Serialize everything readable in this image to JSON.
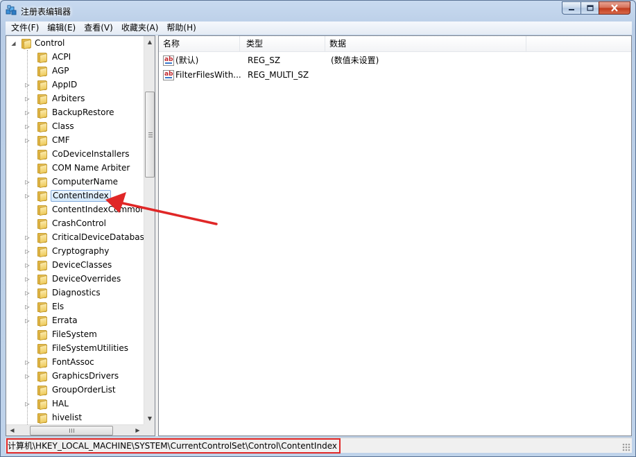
{
  "window": {
    "title": "注册表编辑器",
    "icon": "regedit-icon"
  },
  "menu": [
    {
      "label": "文件(F)"
    },
    {
      "label": "编辑(E)"
    },
    {
      "label": "查看(V)"
    },
    {
      "label": "收藏夹(A)"
    },
    {
      "label": "帮助(H)"
    }
  ],
  "tree": {
    "root": {
      "label": "Control",
      "expanded": true
    },
    "items": [
      {
        "label": "ACPI",
        "has_children": false
      },
      {
        "label": "AGP",
        "has_children": false
      },
      {
        "label": "AppID",
        "has_children": true
      },
      {
        "label": "Arbiters",
        "has_children": true
      },
      {
        "label": "BackupRestore",
        "has_children": true
      },
      {
        "label": "Class",
        "has_children": true
      },
      {
        "label": "CMF",
        "has_children": true
      },
      {
        "label": "CoDeviceInstallers",
        "has_children": false
      },
      {
        "label": "COM Name Arbiter",
        "has_children": false
      },
      {
        "label": "ComputerName",
        "has_children": true
      },
      {
        "label": "ContentIndex",
        "has_children": true,
        "selected": true
      },
      {
        "label": "ContentIndexCommon",
        "has_children": false
      },
      {
        "label": "CrashControl",
        "has_children": false
      },
      {
        "label": "CriticalDeviceDatabase",
        "has_children": true
      },
      {
        "label": "Cryptography",
        "has_children": true
      },
      {
        "label": "DeviceClasses",
        "has_children": true
      },
      {
        "label": "DeviceOverrides",
        "has_children": true
      },
      {
        "label": "Diagnostics",
        "has_children": true
      },
      {
        "label": "Els",
        "has_children": true
      },
      {
        "label": "Errata",
        "has_children": true
      },
      {
        "label": "FileSystem",
        "has_children": false
      },
      {
        "label": "FileSystemUtilities",
        "has_children": false
      },
      {
        "label": "FontAssoc",
        "has_children": true
      },
      {
        "label": "GraphicsDrivers",
        "has_children": true
      },
      {
        "label": "GroupOrderList",
        "has_children": false
      },
      {
        "label": "HAL",
        "has_children": true
      },
      {
        "label": "hivelist",
        "has_children": false
      }
    ]
  },
  "list": {
    "columns": [
      {
        "label": "名称"
      },
      {
        "label": "类型"
      },
      {
        "label": "数据"
      }
    ],
    "rows": [
      {
        "name": "(默认)",
        "type": "REG_SZ",
        "data": "(数值未设置)"
      },
      {
        "name": "FilterFilesWith...",
        "type": "REG_MULTI_SZ",
        "data": ""
      }
    ]
  },
  "status": {
    "path": "计算机\\HKEY_LOCAL_MACHINE\\SYSTEM\\CurrentControlSet\\Control\\ContentIndex"
  },
  "colors": {
    "annotation": "#e02727",
    "selection_border": "#84acdd"
  }
}
